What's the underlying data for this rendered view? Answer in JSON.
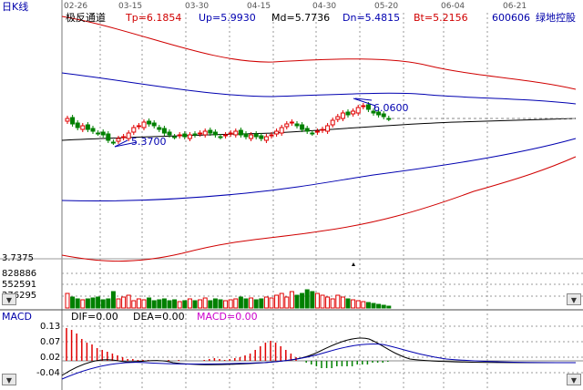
{
  "header": {
    "period": "日K线",
    "indicator": "极反通道",
    "tp": "Tp=6.1854",
    "up": "Up=5.9930",
    "md": "Md=5.7736",
    "dn": "Dn=5.4815",
    "bt": "Bt=5.2156",
    "code": "600606",
    "name": "绿地控股"
  },
  "dates": [
    "02-26",
    "03-15",
    "03-30",
    "04-15",
    "04-30",
    "05-20",
    "06-04",
    "06-21"
  ],
  "price_annotations": {
    "high": "6.0600",
    "low": "5.3700"
  },
  "volume_axis": [
    "3.7375",
    "828886",
    "552591",
    "276295"
  ],
  "macd": {
    "title": "MACD",
    "dif": "DIF=0.00",
    "dea": "DEA=0.00",
    "macd": "MACD=0.00",
    "axis": [
      "0.13",
      "0.07",
      "0.02",
      "-0.04"
    ]
  },
  "colors": {
    "up": "#e00000",
    "down": "#008000",
    "bg": "#ffffff",
    "text": "#000000",
    "accent": "#0000aa",
    "macd_label": "#cc00cc"
  },
  "icons": {
    "collapse_left": "triangle-down-icon",
    "collapse_right": "triangle-down-icon"
  }
}
